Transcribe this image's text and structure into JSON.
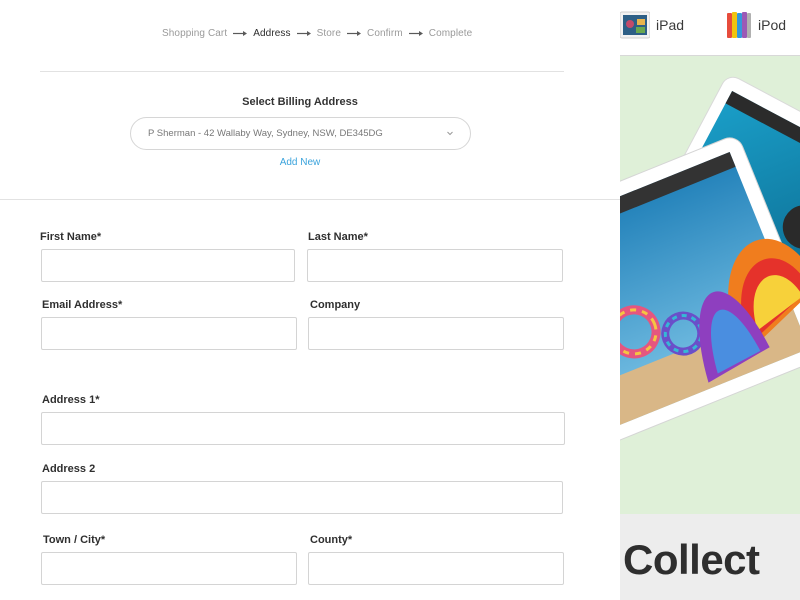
{
  "steps": [
    {
      "label": "Shopping Cart"
    },
    {
      "label": "Address"
    },
    {
      "label": "Store"
    },
    {
      "label": "Confirm"
    },
    {
      "label": "Complete"
    }
  ],
  "active_step": "Address",
  "billing": {
    "title": "Select Billing Address",
    "selected": "P Sherman - 42 Wallaby Way, Sydney, NSW, DE345DG",
    "add_new": "Add New"
  },
  "form": {
    "first_name": {
      "label": "First Name*",
      "value": ""
    },
    "last_name": {
      "label": "Last Name*",
      "value": ""
    },
    "email": {
      "label": "Email Address*",
      "value": ""
    },
    "company": {
      "label": "Company",
      "value": ""
    },
    "address1": {
      "label": "Address 1*",
      "value": ""
    },
    "address2": {
      "label": "Address 2",
      "value": ""
    },
    "town": {
      "label": "Town / City*",
      "value": ""
    },
    "county": {
      "label": "County*",
      "value": ""
    }
  },
  "promo": {
    "nav": [
      {
        "label": "iPad",
        "icon": "ipad-product-icon"
      },
      {
        "label": "iPod",
        "icon": "ipod-product-icon"
      }
    ],
    "headline": "Collect"
  },
  "colors": {
    "link": "#3ba3dc",
    "promo_background": "#dff0d8",
    "border": "#d4d4d4"
  }
}
